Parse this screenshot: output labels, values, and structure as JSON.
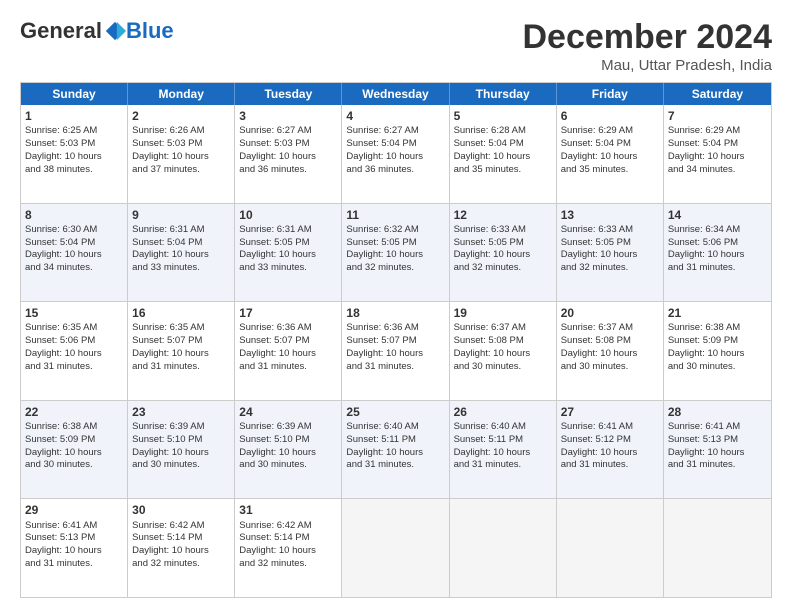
{
  "logo": {
    "general": "General",
    "blue": "Blue"
  },
  "header": {
    "month": "December 2024",
    "location": "Mau, Uttar Pradesh, India"
  },
  "weekdays": [
    "Sunday",
    "Monday",
    "Tuesday",
    "Wednesday",
    "Thursday",
    "Friday",
    "Saturday"
  ],
  "rows": [
    [
      {
        "day": "1",
        "info": "Sunrise: 6:25 AM\nSunset: 5:03 PM\nDaylight: 10 hours\nand 38 minutes."
      },
      {
        "day": "2",
        "info": "Sunrise: 6:26 AM\nSunset: 5:03 PM\nDaylight: 10 hours\nand 37 minutes."
      },
      {
        "day": "3",
        "info": "Sunrise: 6:27 AM\nSunset: 5:03 PM\nDaylight: 10 hours\nand 36 minutes."
      },
      {
        "day": "4",
        "info": "Sunrise: 6:27 AM\nSunset: 5:04 PM\nDaylight: 10 hours\nand 36 minutes."
      },
      {
        "day": "5",
        "info": "Sunrise: 6:28 AM\nSunset: 5:04 PM\nDaylight: 10 hours\nand 35 minutes."
      },
      {
        "day": "6",
        "info": "Sunrise: 6:29 AM\nSunset: 5:04 PM\nDaylight: 10 hours\nand 35 minutes."
      },
      {
        "day": "7",
        "info": "Sunrise: 6:29 AM\nSunset: 5:04 PM\nDaylight: 10 hours\nand 34 minutes."
      }
    ],
    [
      {
        "day": "8",
        "info": "Sunrise: 6:30 AM\nSunset: 5:04 PM\nDaylight: 10 hours\nand 34 minutes."
      },
      {
        "day": "9",
        "info": "Sunrise: 6:31 AM\nSunset: 5:04 PM\nDaylight: 10 hours\nand 33 minutes."
      },
      {
        "day": "10",
        "info": "Sunrise: 6:31 AM\nSunset: 5:05 PM\nDaylight: 10 hours\nand 33 minutes."
      },
      {
        "day": "11",
        "info": "Sunrise: 6:32 AM\nSunset: 5:05 PM\nDaylight: 10 hours\nand 32 minutes."
      },
      {
        "day": "12",
        "info": "Sunrise: 6:33 AM\nSunset: 5:05 PM\nDaylight: 10 hours\nand 32 minutes."
      },
      {
        "day": "13",
        "info": "Sunrise: 6:33 AM\nSunset: 5:05 PM\nDaylight: 10 hours\nand 32 minutes."
      },
      {
        "day": "14",
        "info": "Sunrise: 6:34 AM\nSunset: 5:06 PM\nDaylight: 10 hours\nand 31 minutes."
      }
    ],
    [
      {
        "day": "15",
        "info": "Sunrise: 6:35 AM\nSunset: 5:06 PM\nDaylight: 10 hours\nand 31 minutes."
      },
      {
        "day": "16",
        "info": "Sunrise: 6:35 AM\nSunset: 5:07 PM\nDaylight: 10 hours\nand 31 minutes."
      },
      {
        "day": "17",
        "info": "Sunrise: 6:36 AM\nSunset: 5:07 PM\nDaylight: 10 hours\nand 31 minutes."
      },
      {
        "day": "18",
        "info": "Sunrise: 6:36 AM\nSunset: 5:07 PM\nDaylight: 10 hours\nand 31 minutes."
      },
      {
        "day": "19",
        "info": "Sunrise: 6:37 AM\nSunset: 5:08 PM\nDaylight: 10 hours\nand 30 minutes."
      },
      {
        "day": "20",
        "info": "Sunrise: 6:37 AM\nSunset: 5:08 PM\nDaylight: 10 hours\nand 30 minutes."
      },
      {
        "day": "21",
        "info": "Sunrise: 6:38 AM\nSunset: 5:09 PM\nDaylight: 10 hours\nand 30 minutes."
      }
    ],
    [
      {
        "day": "22",
        "info": "Sunrise: 6:38 AM\nSunset: 5:09 PM\nDaylight: 10 hours\nand 30 minutes."
      },
      {
        "day": "23",
        "info": "Sunrise: 6:39 AM\nSunset: 5:10 PM\nDaylight: 10 hours\nand 30 minutes."
      },
      {
        "day": "24",
        "info": "Sunrise: 6:39 AM\nSunset: 5:10 PM\nDaylight: 10 hours\nand 30 minutes."
      },
      {
        "day": "25",
        "info": "Sunrise: 6:40 AM\nSunset: 5:11 PM\nDaylight: 10 hours\nand 31 minutes."
      },
      {
        "day": "26",
        "info": "Sunrise: 6:40 AM\nSunset: 5:11 PM\nDaylight: 10 hours\nand 31 minutes."
      },
      {
        "day": "27",
        "info": "Sunrise: 6:41 AM\nSunset: 5:12 PM\nDaylight: 10 hours\nand 31 minutes."
      },
      {
        "day": "28",
        "info": "Sunrise: 6:41 AM\nSunset: 5:13 PM\nDaylight: 10 hours\nand 31 minutes."
      }
    ],
    [
      {
        "day": "29",
        "info": "Sunrise: 6:41 AM\nSunset: 5:13 PM\nDaylight: 10 hours\nand 31 minutes."
      },
      {
        "day": "30",
        "info": "Sunrise: 6:42 AM\nSunset: 5:14 PM\nDaylight: 10 hours\nand 32 minutes."
      },
      {
        "day": "31",
        "info": "Sunrise: 6:42 AM\nSunset: 5:14 PM\nDaylight: 10 hours\nand 32 minutes."
      },
      {
        "day": "",
        "info": ""
      },
      {
        "day": "",
        "info": ""
      },
      {
        "day": "",
        "info": ""
      },
      {
        "day": "",
        "info": ""
      }
    ]
  ]
}
